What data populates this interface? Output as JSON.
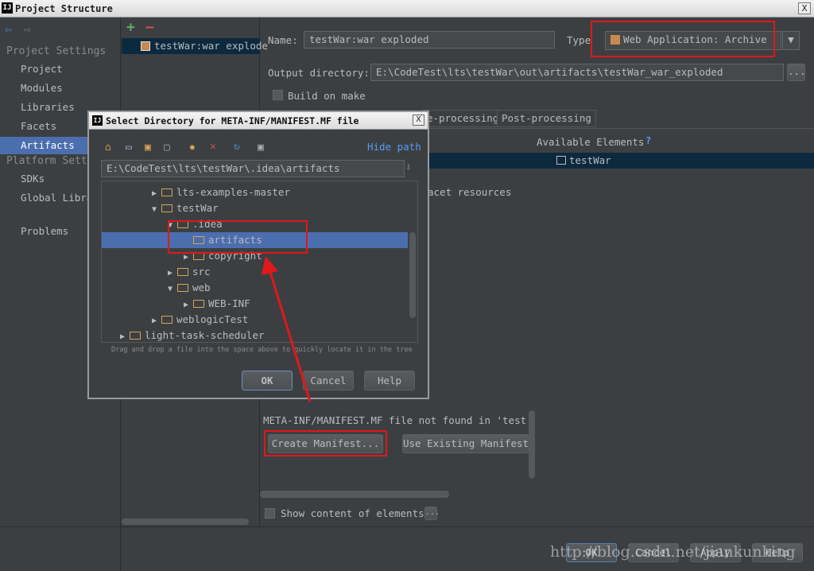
{
  "window": {
    "logo": "IJ",
    "title": "Project Structure",
    "close": "X"
  },
  "sidebar": {
    "project_settings": "Project Settings",
    "items": [
      "Project",
      "Modules",
      "Libraries",
      "Facets",
      "Artifacts"
    ],
    "platform_settings": "Platform Sett",
    "platform_items": [
      "SDKs",
      "Global Libra"
    ],
    "problems": "Problems"
  },
  "artifacts": {
    "add": "+",
    "remove": "−",
    "item": "testWar:war explode"
  },
  "editor": {
    "name_label": "Name:",
    "name_value": "testWar:war exploded",
    "type_label": "Type",
    "type_value": "Web Application: Archive",
    "output_label": "Output directory:",
    "output_value": "E:\\CodeTest\\lts\\testWar\\out\\artifacts\\testWar_war_exploded",
    "build_on_make": "Build on make",
    "tabs": [
      "e-processing",
      "Post-processing"
    ],
    "available_elements": "Available Elements",
    "help_q": "?",
    "available_item": "testWar",
    "facet_resources": "acet resources",
    "manifest_msg": "META-INF/MANIFEST.MF file not found in 'testWar",
    "create_manifest": "Create Manifest...",
    "use_existing": "Use Existing Manifest",
    "show_content": "Show content of elements",
    "more": "..."
  },
  "footer": {
    "ok": "OK",
    "cancel": "Cancel",
    "apply": "Apply",
    "help": "Help"
  },
  "watermark": "http://blog.csdn.net/jiankunking",
  "dialog": {
    "logo": "IJ",
    "title": "Select Directory for META-INF/MANIFEST.MF file",
    "close": "X",
    "hide_path": "Hide path",
    "path_value": "E:\\CodeTest\\lts\\testWar\\.idea\\artifacts",
    "tree": [
      {
        "label": "lts-examples-master",
        "arrow": "▶"
      },
      {
        "label": "testWar",
        "arrow": "▼"
      },
      {
        "label": ".idea",
        "arrow": "▼"
      },
      {
        "label": "artifacts",
        "arrow": ""
      },
      {
        "label": "copyright",
        "arrow": "▶"
      },
      {
        "label": "src",
        "arrow": "▶"
      },
      {
        "label": "web",
        "arrow": "▼"
      },
      {
        "label": "WEB-INF",
        "arrow": "▶"
      },
      {
        "label": "weblogicTest",
        "arrow": "▶"
      },
      {
        "label": "light-task-scheduler",
        "arrow": "▶"
      }
    ],
    "hint": "Drag and drop a file into the space above to quickly locate it in the tree",
    "ok": "OK",
    "cancel": "Cancel",
    "help": "Help"
  },
  "colors": {
    "background": "#3c3f41",
    "selection": "#4b6eaf",
    "highlight": "#e0181b",
    "folder": "#d8a657",
    "link": "#589df6"
  }
}
